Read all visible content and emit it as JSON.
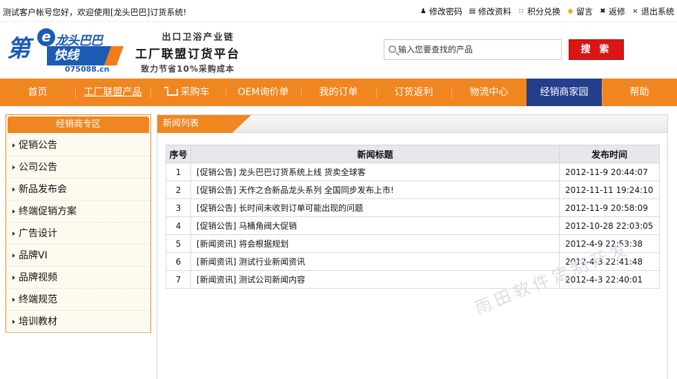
{
  "topbar": {
    "welcome": "测试客户帐号您好，欢迎使用[龙头巴巴]订货系统!",
    "links": [
      {
        "icon": "user-icon",
        "label": "修改密码"
      },
      {
        "icon": "card-icon",
        "label": "修改资料"
      },
      {
        "icon": "grid-icon",
        "label": "积分兑换"
      },
      {
        "icon": "chat-icon",
        "label": "留言"
      },
      {
        "icon": "tools-icon",
        "label": "返修"
      },
      {
        "icon": "close-icon",
        "label": "退出系统"
      }
    ]
  },
  "logo": {
    "mark": "第",
    "e": "e",
    "brand": "龙头巴巴",
    "kuaixian": "快线",
    "domain": "075088.cn"
  },
  "slogan": {
    "line1": "出口卫浴产业链",
    "line2": "工厂联盟订货平台",
    "line3": "致力节省10%采购成本"
  },
  "search": {
    "placeholder": "输入您要查找的产品",
    "button": "搜 索"
  },
  "nav": {
    "items": [
      {
        "label": "首页"
      },
      {
        "label": "工厂联盟产品"
      },
      {
        "label": "采购车",
        "icon": "cart-icon"
      },
      {
        "label": "OEM询价单"
      },
      {
        "label": "我的订单"
      },
      {
        "label": "订货返利"
      },
      {
        "label": "物流中心"
      },
      {
        "label": "经销商家园"
      },
      {
        "label": "帮助"
      }
    ]
  },
  "sidebar": {
    "title": "经销商专区",
    "items": [
      "促销公告",
      "公司公告",
      "新品发布会",
      "终端促销方案",
      "广告设计",
      "品牌VI",
      "品牌视频",
      "终端规范",
      "培训教材"
    ]
  },
  "main": {
    "tab": "新闻列表",
    "columns": [
      "序号",
      "新闻标题",
      "发布时间"
    ],
    "rows": [
      {
        "no": "1",
        "title": "[促销公告] 龙头巴巴订货系统上线 货卖全球客",
        "time": "2012-11-9 20:44:07"
      },
      {
        "no": "2",
        "title": "[促销公告] 天作之合新品龙头系列 全国同步发布上市!",
        "time": "2012-11-11 19:24:10"
      },
      {
        "no": "3",
        "title": "[促销公告] 长时间未收到订单可能出现的问题",
        "time": "2012-11-9 20:58:09"
      },
      {
        "no": "4",
        "title": "[促销公告] 马桶角阀大促销",
        "time": "2012-10-28 22:03:05"
      },
      {
        "no": "5",
        "title": "[新闻资讯] 将会根据规划",
        "time": "2012-4-9 22:53:38"
      },
      {
        "no": "6",
        "title": "[新闻资讯] 测试行业新闻资讯",
        "time": "2012-4-3 22:41:48"
      },
      {
        "no": "7",
        "title": "[新闻资讯] 测试公司新闻内容",
        "time": "2012-4-3 22:40:01"
      }
    ]
  },
  "watermark": "雨田软件定制开发",
  "colors": {
    "accent": "#f0861f",
    "nav_active": "#233e8a",
    "search_button": "#d91515",
    "brand_blue": "#1c5bb3"
  }
}
